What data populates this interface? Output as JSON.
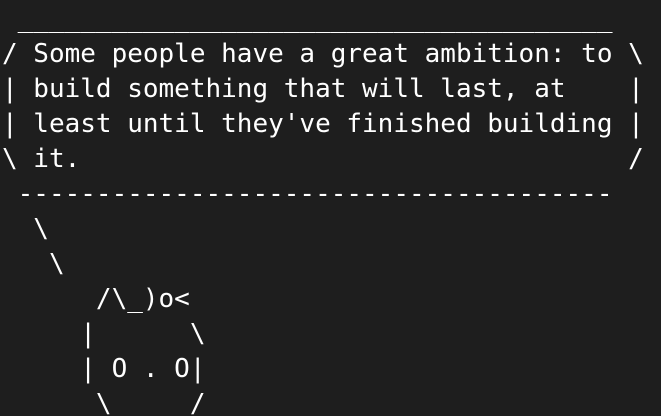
{
  "terminal": {
    "background": "#1e1e1e",
    "foreground": "#ffffff",
    "lines": [
      " ______________________________________",
      "/ Some people have a great ambition: to \\",
      "| build something that will last, at    |",
      "| least until they've finished building |",
      "\\ it.                                   /",
      " --------------------------------------",
      "  \\",
      "   \\",
      "      /\\_)o<",
      "     |      \\",
      "     | O . O|",
      "      \\_____/"
    ]
  }
}
